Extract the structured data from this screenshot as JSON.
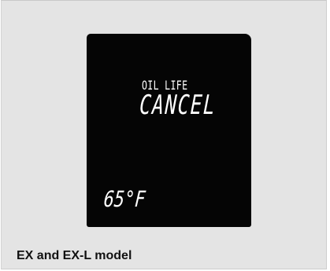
{
  "display": {
    "oil_life_label": "OIL LIFE",
    "status_text": "CANCEL",
    "temperature": "65°F"
  },
  "caption": "EX and EX-L model"
}
